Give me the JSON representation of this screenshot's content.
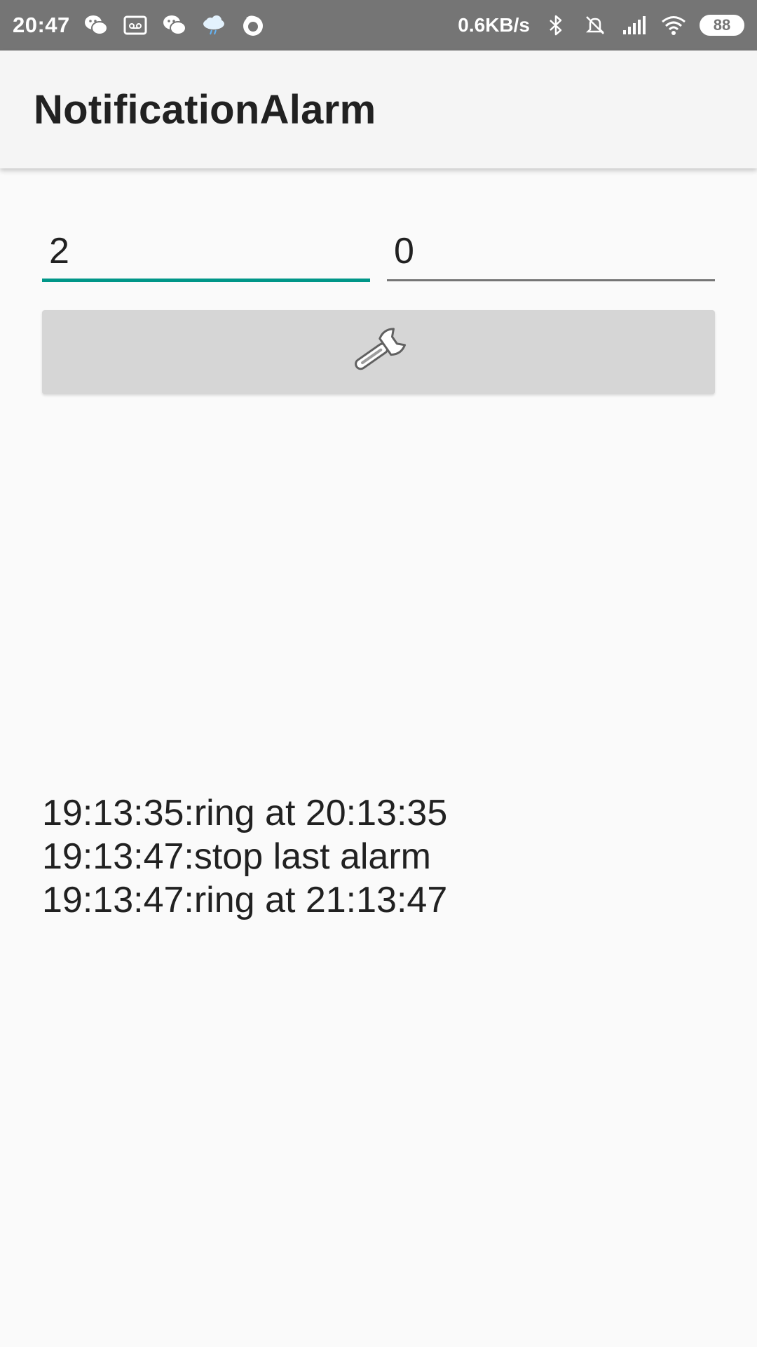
{
  "status_bar": {
    "time": "20:47",
    "network_speed": "0.6KB/s",
    "battery_level": "88",
    "left_icons": [
      "wechat-icon",
      "voicemail-icon",
      "wechat-icon",
      "cloud-rain-icon",
      "firefox-icon"
    ],
    "right_icons": [
      "bluetooth-icon",
      "bell-muted-icon",
      "signal-icon",
      "wifi-icon",
      "battery-icon"
    ],
    "background_color": "#757575"
  },
  "app_bar": {
    "title": "NotificationAlarm",
    "background_color": "#f5f5f5"
  },
  "form": {
    "hours_value": "2",
    "minutes_value": "0",
    "focused_underline_color": "#009688",
    "set_button_icon": "wrench-icon"
  },
  "log": {
    "lines": [
      "19:13:35:ring at 20:13:35",
      "19:13:47:stop last alarm",
      "19:13:47:ring at 21:13:47"
    ]
  }
}
